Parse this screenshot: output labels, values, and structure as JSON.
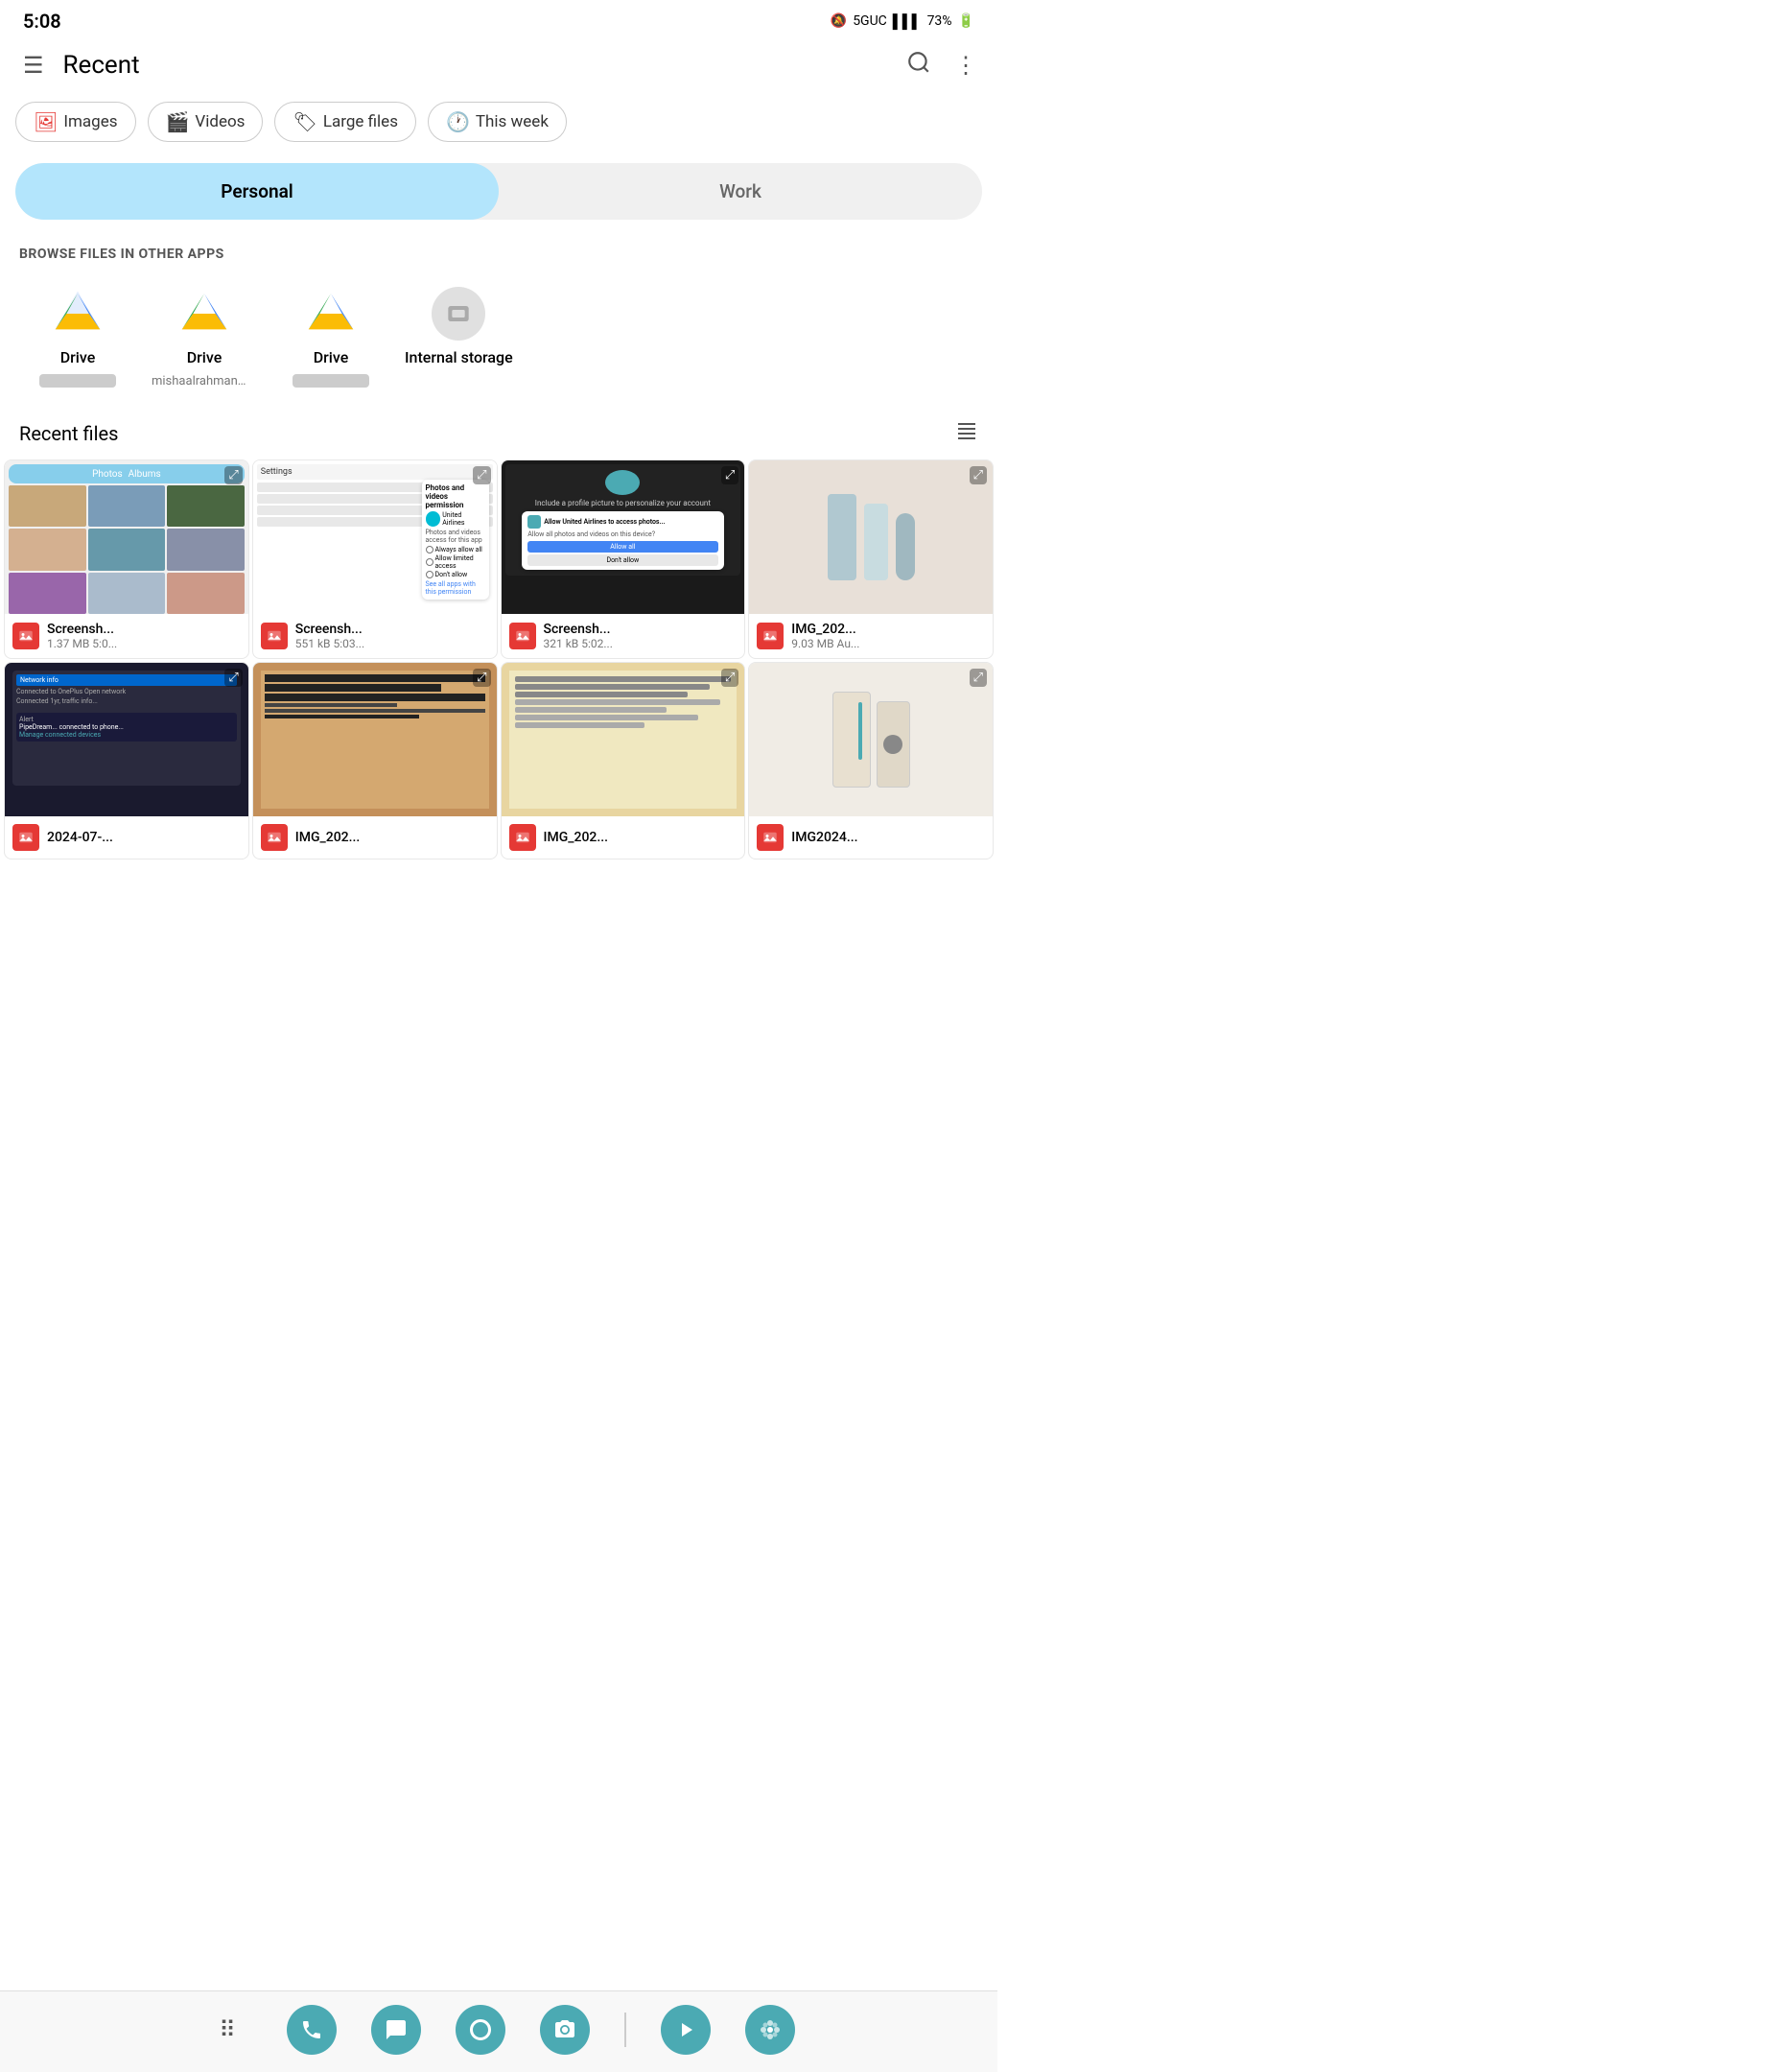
{
  "status": {
    "time": "5:08",
    "network": "5GUC",
    "signal": "▌▌▌",
    "battery": "73%"
  },
  "header": {
    "menu_label": "☰",
    "title": "Recent",
    "search_label": "🔍",
    "more_label": "⋮"
  },
  "filters": [
    {
      "id": "images",
      "icon": "🖼",
      "label": "Images",
      "active": true
    },
    {
      "id": "videos",
      "icon": "🎬",
      "label": "Videos",
      "active": false
    },
    {
      "id": "large_files",
      "icon": "🏷",
      "label": "Large files",
      "active": false
    },
    {
      "id": "this_week",
      "icon": "🕐",
      "label": "This week",
      "active": false
    }
  ],
  "tabs": [
    {
      "id": "personal",
      "label": "Personal",
      "active": true
    },
    {
      "id": "work",
      "label": "Work",
      "active": false
    }
  ],
  "browse_section": {
    "title": "BROWSE FILES IN OTHER APPS",
    "apps": [
      {
        "name": "Drive",
        "sub": "@gmail.co...",
        "blurred": true
      },
      {
        "name": "Drive",
        "sub": "mishaalrahman@pro...",
        "blurred": false
      },
      {
        "name": "Drive",
        "sub": "@gm...",
        "blurred": true
      },
      {
        "name": "Internal storage",
        "sub": "",
        "blurred": false
      }
    ]
  },
  "recent_files": {
    "title": "Recent files",
    "files": [
      {
        "name": "Screensh...",
        "size": "1.37 MB 5:0...",
        "type": "image"
      },
      {
        "name": "Screensh...",
        "size": "551 kB 5:03...",
        "type": "image"
      },
      {
        "name": "Screensh...",
        "size": "321 kB 5:02...",
        "type": "image"
      },
      {
        "name": "IMG_202...",
        "size": "9.03 MB Au...",
        "type": "image"
      },
      {
        "name": "2024-07-...",
        "size": "",
        "type": "image"
      },
      {
        "name": "IMG_202...",
        "size": "",
        "type": "image"
      },
      {
        "name": "IMG_202...",
        "size": "",
        "type": "image"
      },
      {
        "name": "IMG2024...",
        "size": "",
        "type": "image"
      }
    ]
  },
  "bottom_nav": {
    "icons": [
      "phone",
      "chat",
      "browser",
      "camera",
      "play",
      "flower"
    ]
  }
}
